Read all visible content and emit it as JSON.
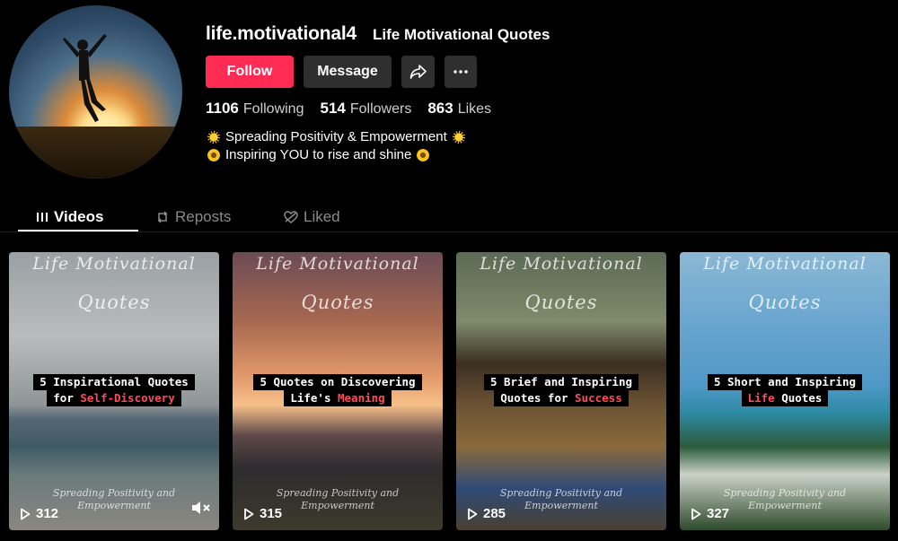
{
  "profile": {
    "username": "life.motivational4",
    "nickname": "Life Motivational Quotes",
    "follow_label": "Follow",
    "message_label": "Message",
    "stats": [
      {
        "value": "1106",
        "label": "Following"
      },
      {
        "value": "514",
        "label": "Followers"
      },
      {
        "value": "863",
        "label": "Likes"
      }
    ],
    "bio": [
      "Spreading Positivity & Empowerment",
      "Inspiring YOU to rise and shine"
    ]
  },
  "tabs": [
    {
      "label": "Videos",
      "icon": "grid-icon",
      "active": true
    },
    {
      "label": "Reposts",
      "icon": "repost-icon",
      "active": false
    },
    {
      "label": "Liked",
      "icon": "heart-hidden-icon",
      "active": false
    }
  ],
  "videos": [
    {
      "script_top": "Life Motivational",
      "script_bottom": "Quotes",
      "caption_line1": "5 Inspirational Quotes",
      "caption_line2_pre": "for ",
      "caption_line2_hl": "Self-Discovery",
      "footer_line1": "Spreading Positivity and",
      "footer_line2": "Empowerment",
      "views": "312",
      "muted": true
    },
    {
      "script_top": "Life Motivational",
      "script_bottom": "Quotes",
      "caption_line1": "5 Quotes on Discovering",
      "caption_line2_pre": "Life's ",
      "caption_line2_hl": "Meaning",
      "footer_line1": "Spreading Positivity and",
      "footer_line2": "Empowerment",
      "views": "315",
      "muted": false
    },
    {
      "script_top": "Life Motivational",
      "script_bottom": "Quotes",
      "caption_line1": "5 Brief and Inspiring",
      "caption_line2_pre": "Quotes for ",
      "caption_line2_hl": "Success",
      "footer_line1": "Spreading Positivity and",
      "footer_line2": "Empowerment",
      "views": "285",
      "muted": false
    },
    {
      "script_top": "Life Motivational",
      "script_bottom": "Quotes",
      "caption_line1": "5 Short and Inspiring",
      "caption_line2_pre": "",
      "caption_line2_hl": "Life",
      "caption_line2_post": " Quotes",
      "footer_line1": "Spreading Positivity and",
      "footer_line2": "Empowerment",
      "views": "327",
      "muted": false
    }
  ],
  "colors": {
    "follow": "#fe2c55",
    "highlight": "#ff4b57",
    "button_dark": "#2f2f2f"
  }
}
